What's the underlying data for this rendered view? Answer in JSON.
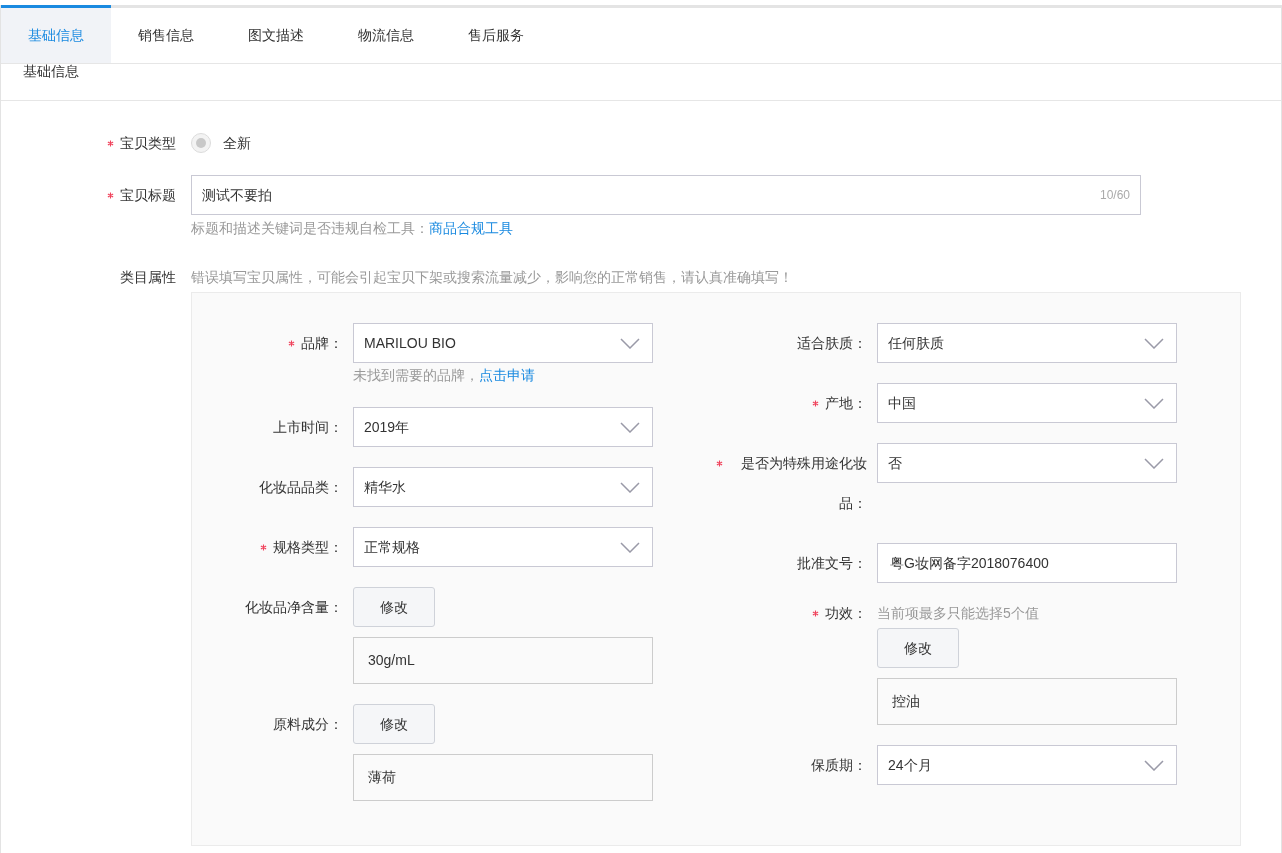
{
  "tabs": [
    {
      "label": "基础信息",
      "selected": true
    },
    {
      "label": "销售信息",
      "selected": false
    },
    {
      "label": "图文描述",
      "selected": false
    },
    {
      "label": "物流信息",
      "selected": false
    },
    {
      "label": "售后服务",
      "selected": false
    }
  ],
  "section_title": "基础信息",
  "item_type": {
    "label": "宝贝类型",
    "required": true,
    "options": [
      {
        "label": "全新",
        "selected": true,
        "disabled": true
      }
    ]
  },
  "item_title": {
    "label": "宝贝标题",
    "required": true,
    "value": "测试不要拍",
    "counter": "10/60",
    "hint": "标题和描述关键词是否违规自检工具：",
    "hint_link": "商品合规工具"
  },
  "category_attributes": {
    "label": "类目属性",
    "notice": "错误填写宝贝属性，可能会引起宝贝下架或搜索流量减少，影响您的正常销售，请认真准确填写！",
    "left_fields": [
      {
        "kind": "select",
        "label": "品牌：",
        "required": true,
        "value": "MARILOU BIO",
        "note": "未找到需要的品牌，",
        "note_link": "点击申请"
      },
      {
        "kind": "select",
        "label": "上市时间：",
        "required": false,
        "value": "2019年"
      },
      {
        "kind": "select",
        "label": "化妆品品类：",
        "required": false,
        "value": "精华水"
      },
      {
        "kind": "select",
        "label": "规格类型：",
        "required": true,
        "value": "正常规格"
      },
      {
        "kind": "modify",
        "label": "化妆品净含量：",
        "required": false,
        "button": "修改",
        "value": "30g/mL"
      },
      {
        "kind": "modify",
        "label": "原料成分：",
        "required": false,
        "button": "修改",
        "value": "薄荷"
      }
    ],
    "right_fields": [
      {
        "kind": "select",
        "label": "适合肤质：",
        "required": false,
        "value": "任何肤质"
      },
      {
        "kind": "select",
        "label": "产地：",
        "required": true,
        "value": "中国"
      },
      {
        "kind": "select",
        "label": "是否为特殊用途化妆品：",
        "required": true,
        "value": "否"
      },
      {
        "kind": "text",
        "label": "批准文号：",
        "required": false,
        "value": "粤G妆网备字2018076400"
      },
      {
        "kind": "modify",
        "label": "功效：",
        "required": true,
        "top_note": "当前项最多只能选择5个值",
        "button": "修改",
        "value": "控油"
      },
      {
        "kind": "select",
        "label": "保质期：",
        "required": false,
        "value": "24个月"
      }
    ]
  }
}
